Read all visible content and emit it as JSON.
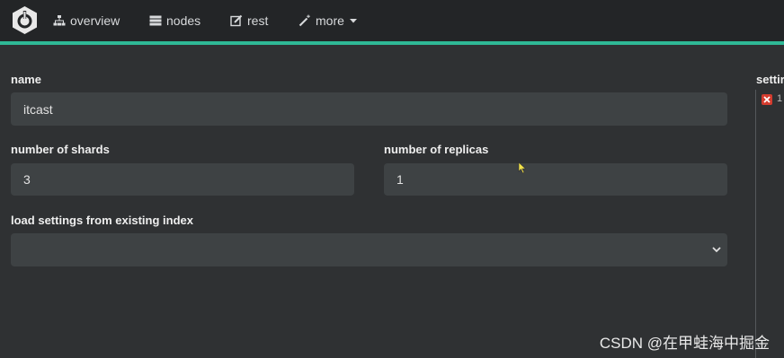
{
  "nav": {
    "overview": "overview",
    "nodes": "nodes",
    "rest": "rest",
    "more": "more"
  },
  "form": {
    "name_label": "name",
    "name_value": "itcast",
    "shards_label": "number of shards",
    "shards_value": "3",
    "replicas_label": "number of replicas",
    "replicas_value": "1",
    "load_settings_label": "load settings from existing index",
    "load_settings_value": ""
  },
  "side_panel": {
    "title": "settir",
    "error_count": "1"
  },
  "watermark": "CSDN @在甲蛙海中掘金",
  "colors": {
    "accent": "#2fb896",
    "navbar": "#232527",
    "background": "#2f3133",
    "field": "#3e4244",
    "error": "#d43c2f"
  },
  "icons": [
    "logo-icon",
    "sitemap-icon",
    "database-icon",
    "edit-icon",
    "magic-wand-icon",
    "caret-down-icon",
    "chevron-down-icon",
    "error-x-icon",
    "mouse-cursor-icon"
  ]
}
